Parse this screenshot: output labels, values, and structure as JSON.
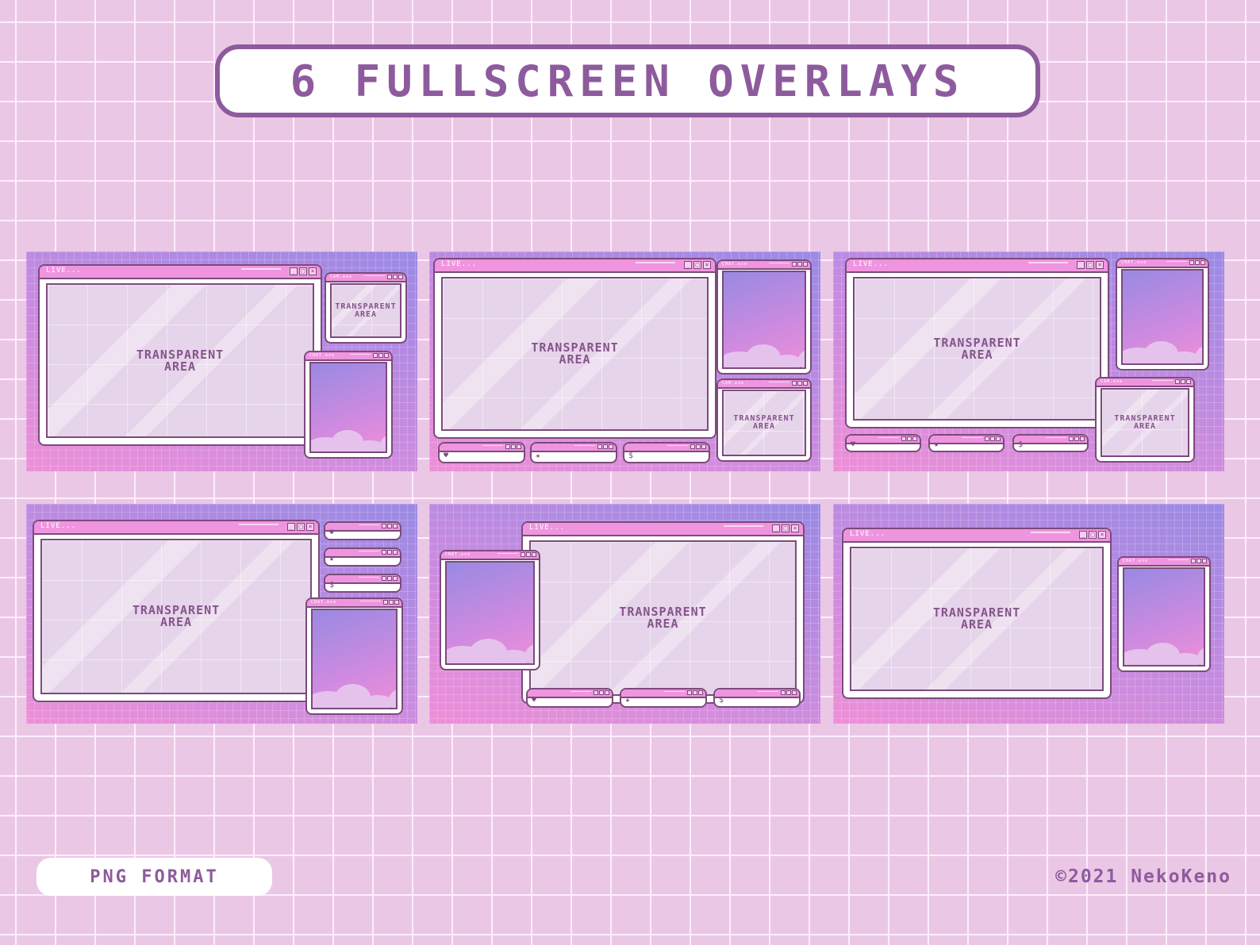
{
  "header": {
    "title": "6 FULLSCREEN OVERLAYS"
  },
  "footer": {
    "format_label": "PNG FORMAT",
    "copyright": "©2021 NekoKeno"
  },
  "window_titles": {
    "live": "LIVE...",
    "chat": "CHAT.exe",
    "cam": "CAM.exe"
  },
  "glass_label": {
    "line1": "TRANSPARENT",
    "line2": "AREA"
  },
  "alert_icons": {
    "follow": "♥",
    "sub": "★",
    "donation": "$"
  },
  "window_controls": {
    "minimize": "_",
    "maximize": "□",
    "close": "×"
  },
  "colors": {
    "background": "#ebc7e6",
    "accent": "#8d5b9d",
    "titlebar": "#ef95df",
    "outline": "#7c4a7c",
    "gradient_pink": "#ee8fd8",
    "gradient_violet": "#9a8ae4"
  },
  "overlays": [
    {
      "name": "overlay-1",
      "windows": [
        "LIVE...",
        "CAM.exe",
        "CHAT.exe"
      ]
    },
    {
      "name": "overlay-2",
      "windows": [
        "LIVE...",
        "CHAT.exe",
        "CAM.exe",
        "follow",
        "sub",
        "donation"
      ]
    },
    {
      "name": "overlay-3",
      "windows": [
        "LIVE...",
        "CHAT.exe",
        "CAM.exe",
        "follow",
        "sub",
        "donation"
      ]
    },
    {
      "name": "overlay-4",
      "windows": [
        "LIVE...",
        "follow",
        "sub",
        "donation",
        "CHAT.exe"
      ]
    },
    {
      "name": "overlay-5",
      "windows": [
        "LIVE...",
        "CHAT.exe",
        "follow",
        "sub",
        "donation"
      ]
    },
    {
      "name": "overlay-6",
      "windows": [
        "LIVE...",
        "CHAT.exe"
      ]
    }
  ]
}
